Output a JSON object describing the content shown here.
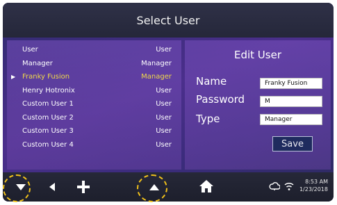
{
  "title": "Select User",
  "users": [
    {
      "name": "User",
      "type": "User",
      "selected": false
    },
    {
      "name": "Manager",
      "type": "Manager",
      "selected": false
    },
    {
      "name": "Franky Fusion",
      "type": "Manager",
      "selected": true
    },
    {
      "name": "Henry Hotronix",
      "type": "User",
      "selected": false
    },
    {
      "name": "Custom User 1",
      "type": "User",
      "selected": false
    },
    {
      "name": "Custom User 2",
      "type": "User",
      "selected": false
    },
    {
      "name": "Custom User 3",
      "type": "User",
      "selected": false
    },
    {
      "name": "Custom User 4",
      "type": "User",
      "selected": false
    }
  ],
  "edit": {
    "title": "Edit User",
    "name_label": "Name",
    "name_value": "Franky Fusion",
    "password_label": "Password",
    "password_value": "M",
    "type_label": "Type",
    "type_value": "Manager",
    "save_label": "Save"
  },
  "status": {
    "time": "8:53 AM",
    "date": "1/23/2018"
  },
  "colors": {
    "highlight": "#f1d94a",
    "annotation": "#f2c21a"
  }
}
